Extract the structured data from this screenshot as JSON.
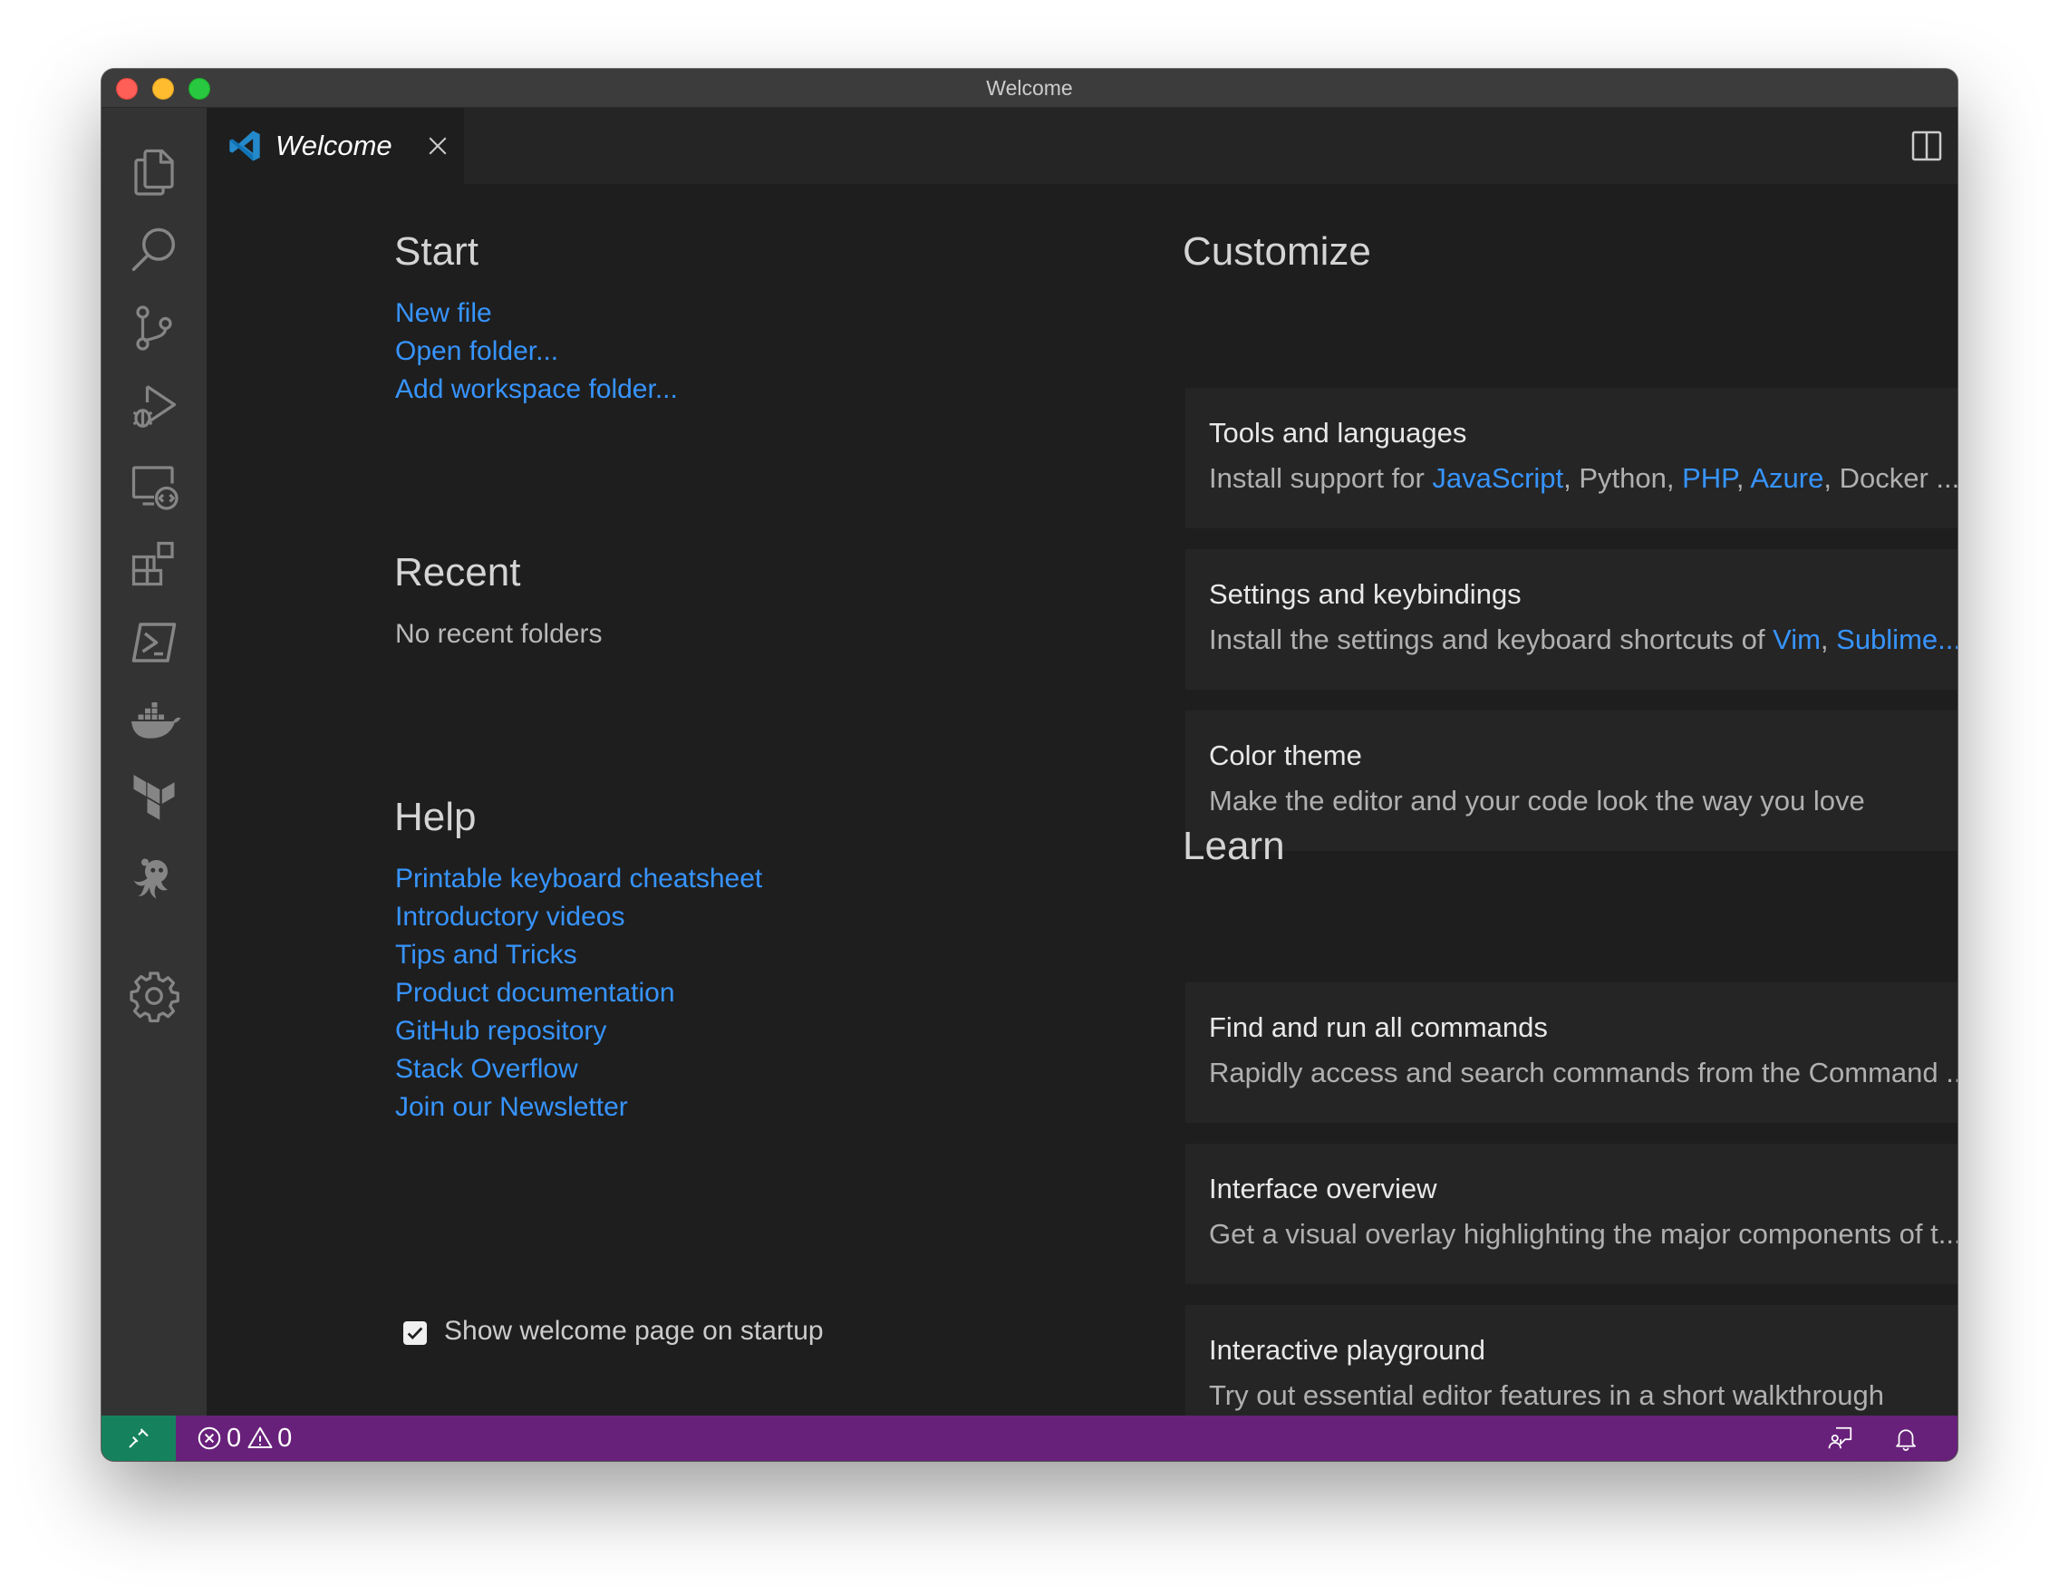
{
  "window": {
    "title": "Welcome"
  },
  "tab": {
    "label": "Welcome"
  },
  "start": {
    "heading": "Start",
    "links": [
      "New file",
      "Open folder...",
      "Add workspace folder..."
    ]
  },
  "recent": {
    "heading": "Recent",
    "empty_text": "No recent folders"
  },
  "help": {
    "heading": "Help",
    "links": [
      "Printable keyboard cheatsheet",
      "Introductory videos",
      "Tips and Tricks",
      "Product documentation",
      "GitHub repository",
      "Stack Overflow",
      "Join our Newsletter"
    ]
  },
  "startup": {
    "label": "Show welcome page on startup",
    "checked": true
  },
  "customize": {
    "heading": "Customize",
    "cards": [
      {
        "title": "Tools and languages",
        "desc_parts": [
          {
            "text": "Install support for ",
            "link": false
          },
          {
            "text": "JavaScript",
            "link": true
          },
          {
            "text": ", Python, ",
            "link": false
          },
          {
            "text": "PHP",
            "link": true
          },
          {
            "text": ", ",
            "link": false
          },
          {
            "text": "Azure",
            "link": true
          },
          {
            "text": ", Docker ...",
            "link": false
          }
        ]
      },
      {
        "title": "Settings and keybindings",
        "desc_parts": [
          {
            "text": "Install the settings and keyboard shortcuts of ",
            "link": false
          },
          {
            "text": "Vim",
            "link": true
          },
          {
            "text": ", ",
            "link": false
          },
          {
            "text": "Sublime...",
            "link": true
          }
        ]
      },
      {
        "title": "Color theme",
        "desc_parts": [
          {
            "text": "Make the editor and your code look the way you love",
            "link": false
          }
        ]
      }
    ]
  },
  "learn": {
    "heading": "Learn",
    "cards": [
      {
        "title": "Find and run all commands",
        "desc": "Rapidly access and search commands from the Command ..."
      },
      {
        "title": "Interface overview",
        "desc": "Get a visual overlay highlighting the major components of t..."
      },
      {
        "title": "Interactive playground",
        "desc": "Try out essential editor features in a short walkthrough"
      }
    ]
  },
  "statusbar": {
    "errors": "0",
    "warnings": "0",
    "color": "#68217a",
    "remote_color": "#16825d"
  },
  "activity_icons": [
    "explorer-icon",
    "search-icon",
    "source-control-icon",
    "run-debug-icon",
    "remote-explorer-icon",
    "extensions-icon",
    "powershell-icon",
    "docker-icon",
    "terraform-icon",
    "octopus-icon",
    "settings-gear-icon"
  ],
  "colors": {
    "link": "#3794ff",
    "accent": "#007acc"
  }
}
